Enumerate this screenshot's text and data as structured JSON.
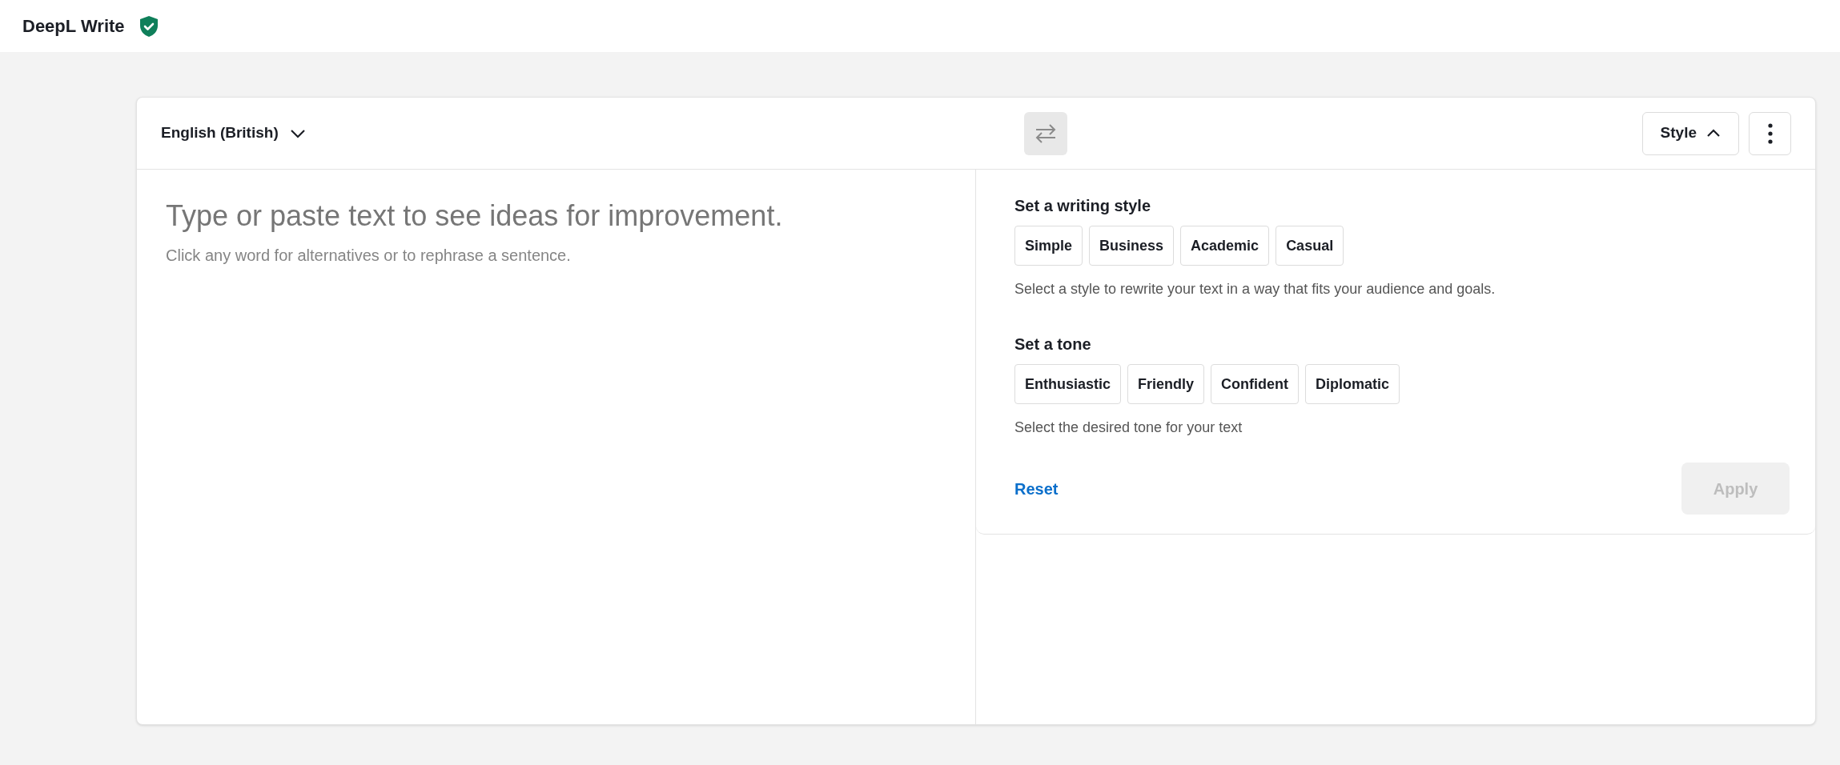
{
  "header": {
    "title": "DeepL Write"
  },
  "toolbar": {
    "language": "English (British)",
    "style_button": {
      "label": "Style",
      "expanded": true
    }
  },
  "editor": {
    "placeholder": "Type or paste text to see ideas for improvement.",
    "hint": "Click any word for alternatives or to rephrase a sentence."
  },
  "style_panel": {
    "sections": [
      {
        "heading": "Set a writing style",
        "options": [
          {
            "label": "Simple",
            "selected": false
          },
          {
            "label": "Business",
            "selected": false
          },
          {
            "label": "Academic",
            "selected": false
          },
          {
            "label": "Casual",
            "selected": false
          }
        ],
        "description": "Select a style to rewrite your text in a way that fits your audience and goals."
      },
      {
        "heading": "Set a tone",
        "options": [
          {
            "label": "Enthusiastic",
            "selected": false
          },
          {
            "label": "Friendly",
            "selected": false
          },
          {
            "label": "Confident",
            "selected": false
          },
          {
            "label": "Diplomatic",
            "selected": false
          }
        ],
        "description": "Select the desired tone for your text"
      }
    ],
    "reset": "Reset",
    "apply": {
      "label": "Apply",
      "disabled": true
    }
  }
}
